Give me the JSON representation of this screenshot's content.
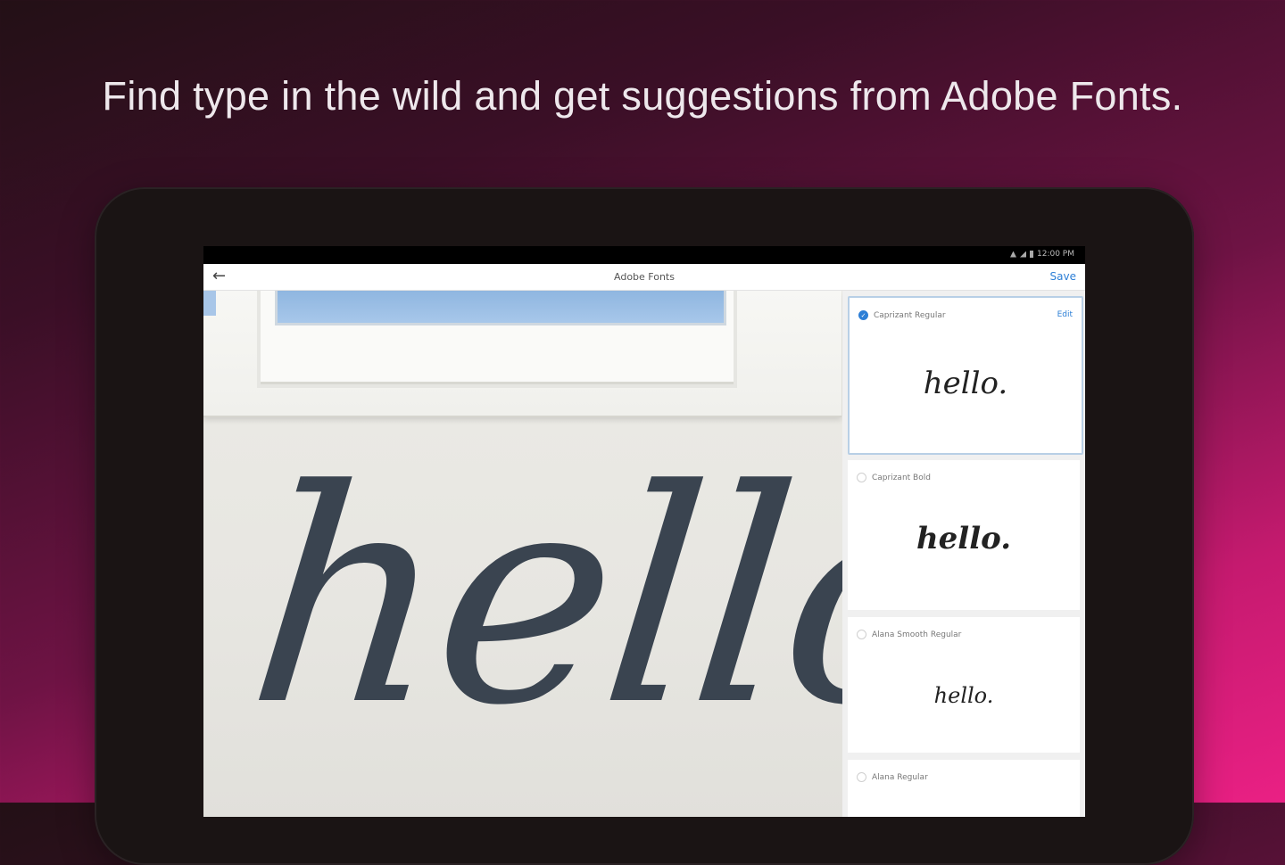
{
  "headline": "Find type in the wild and get suggestions from Adobe Fonts.",
  "status_bar": {
    "time": "12:00 PM"
  },
  "app_bar": {
    "title": "Adobe Fonts",
    "save_label": "Save"
  },
  "photo": {
    "sample_text": "hello."
  },
  "suggestions": [
    {
      "name": "Caprizant Regular",
      "sample": "hello.",
      "selected": true,
      "edit_label": "Edit"
    },
    {
      "name": "Caprizant Bold",
      "sample": "hello.",
      "selected": false
    },
    {
      "name": "Alana Smooth Regular",
      "sample": "hello.",
      "selected": false
    },
    {
      "name": "Alana Regular",
      "sample": "",
      "selected": false
    }
  ],
  "colors": {
    "accent": "#2d7fd6",
    "bg_dark": "#231016",
    "bg_pink": "#ea2084"
  }
}
